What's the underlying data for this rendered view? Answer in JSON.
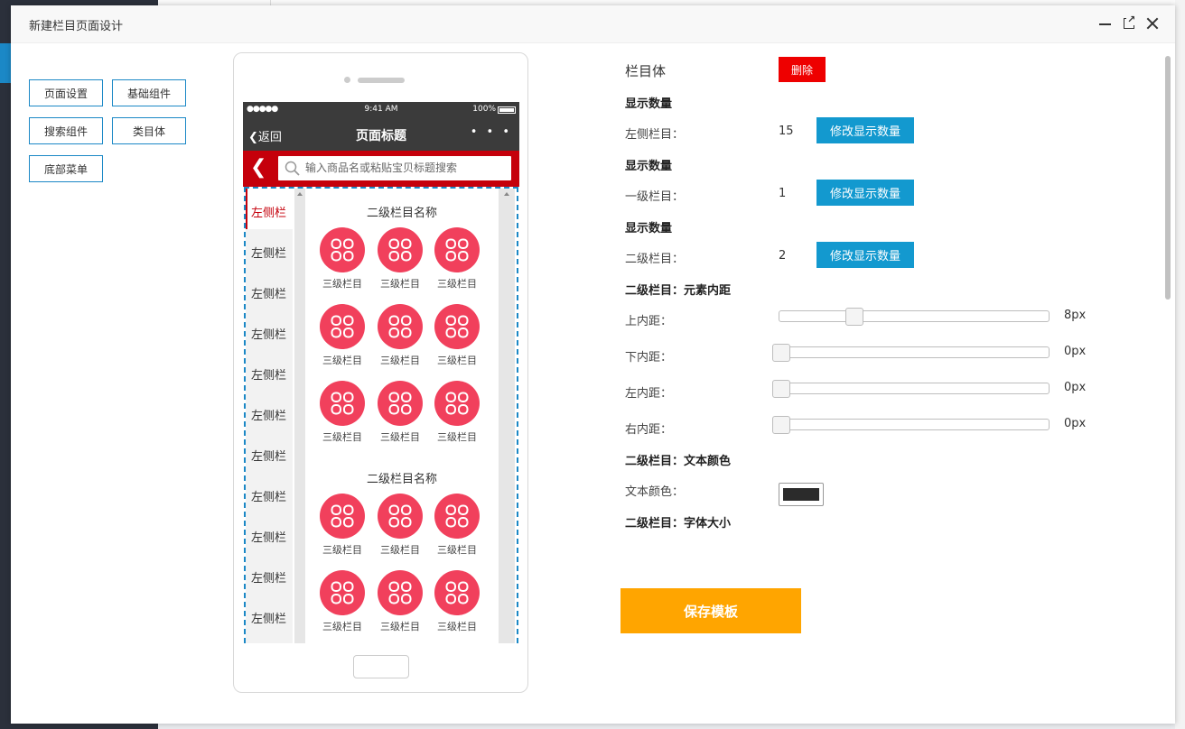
{
  "modal": {
    "title": "新建栏目页面设计"
  },
  "components": {
    "buttons": [
      "页面设置",
      "基础组件",
      "搜索组件",
      "类目体",
      "底部菜单"
    ]
  },
  "phone": {
    "status": {
      "signal": "●●●●● ",
      "time": "9:41 AM",
      "battery": "100%"
    },
    "nav": {
      "back": "返回",
      "title": "页面标题",
      "more": "• • •"
    },
    "search": {
      "placeholder": "输入商品名或粘贴宝贝标题搜索"
    },
    "left_items": [
      "左侧栏",
      "左侧栏",
      "左侧栏",
      "左侧栏",
      "左侧栏",
      "左侧栏",
      "左侧栏",
      "左侧栏",
      "左侧栏",
      "左侧栏",
      "左侧栏"
    ],
    "sub_titles": [
      "二级栏目名称",
      "二级栏目名称"
    ],
    "cat_label": "三级栏目",
    "colors": {
      "nav_bg": "#3b3b3b",
      "search_bg": "#c5000b",
      "circle": "#f1405c"
    }
  },
  "panel": {
    "heading": "栏目体",
    "delete_label": "删除",
    "sections": {
      "count1": "显示数量",
      "count2": "显示数量",
      "count3": "显示数量",
      "padding": "二级栏目：元素内距",
      "text_color": "二级栏目：文本颜色",
      "font_size": "二级栏目：字体大小"
    },
    "counts": [
      {
        "label": "左侧栏目：",
        "value": "15",
        "button": "修改显示数量"
      },
      {
        "label": "一级栏目：",
        "value": "1",
        "button": "修改显示数量"
      },
      {
        "label": "二级栏目：",
        "value": "2",
        "button": "修改显示数量"
      }
    ],
    "paddings": [
      {
        "label": "上内距：",
        "value": "8px",
        "fraction": 0.27
      },
      {
        "label": "下内距：",
        "value": "0px",
        "fraction": 0
      },
      {
        "label": "左内距：",
        "value": "0px",
        "fraction": 0
      },
      {
        "label": "右内距：",
        "value": "0px",
        "fraction": 0
      }
    ],
    "text_color_label": "文本颜色：",
    "text_color_value": "#2b2b2b"
  },
  "save_label": "保存模板"
}
